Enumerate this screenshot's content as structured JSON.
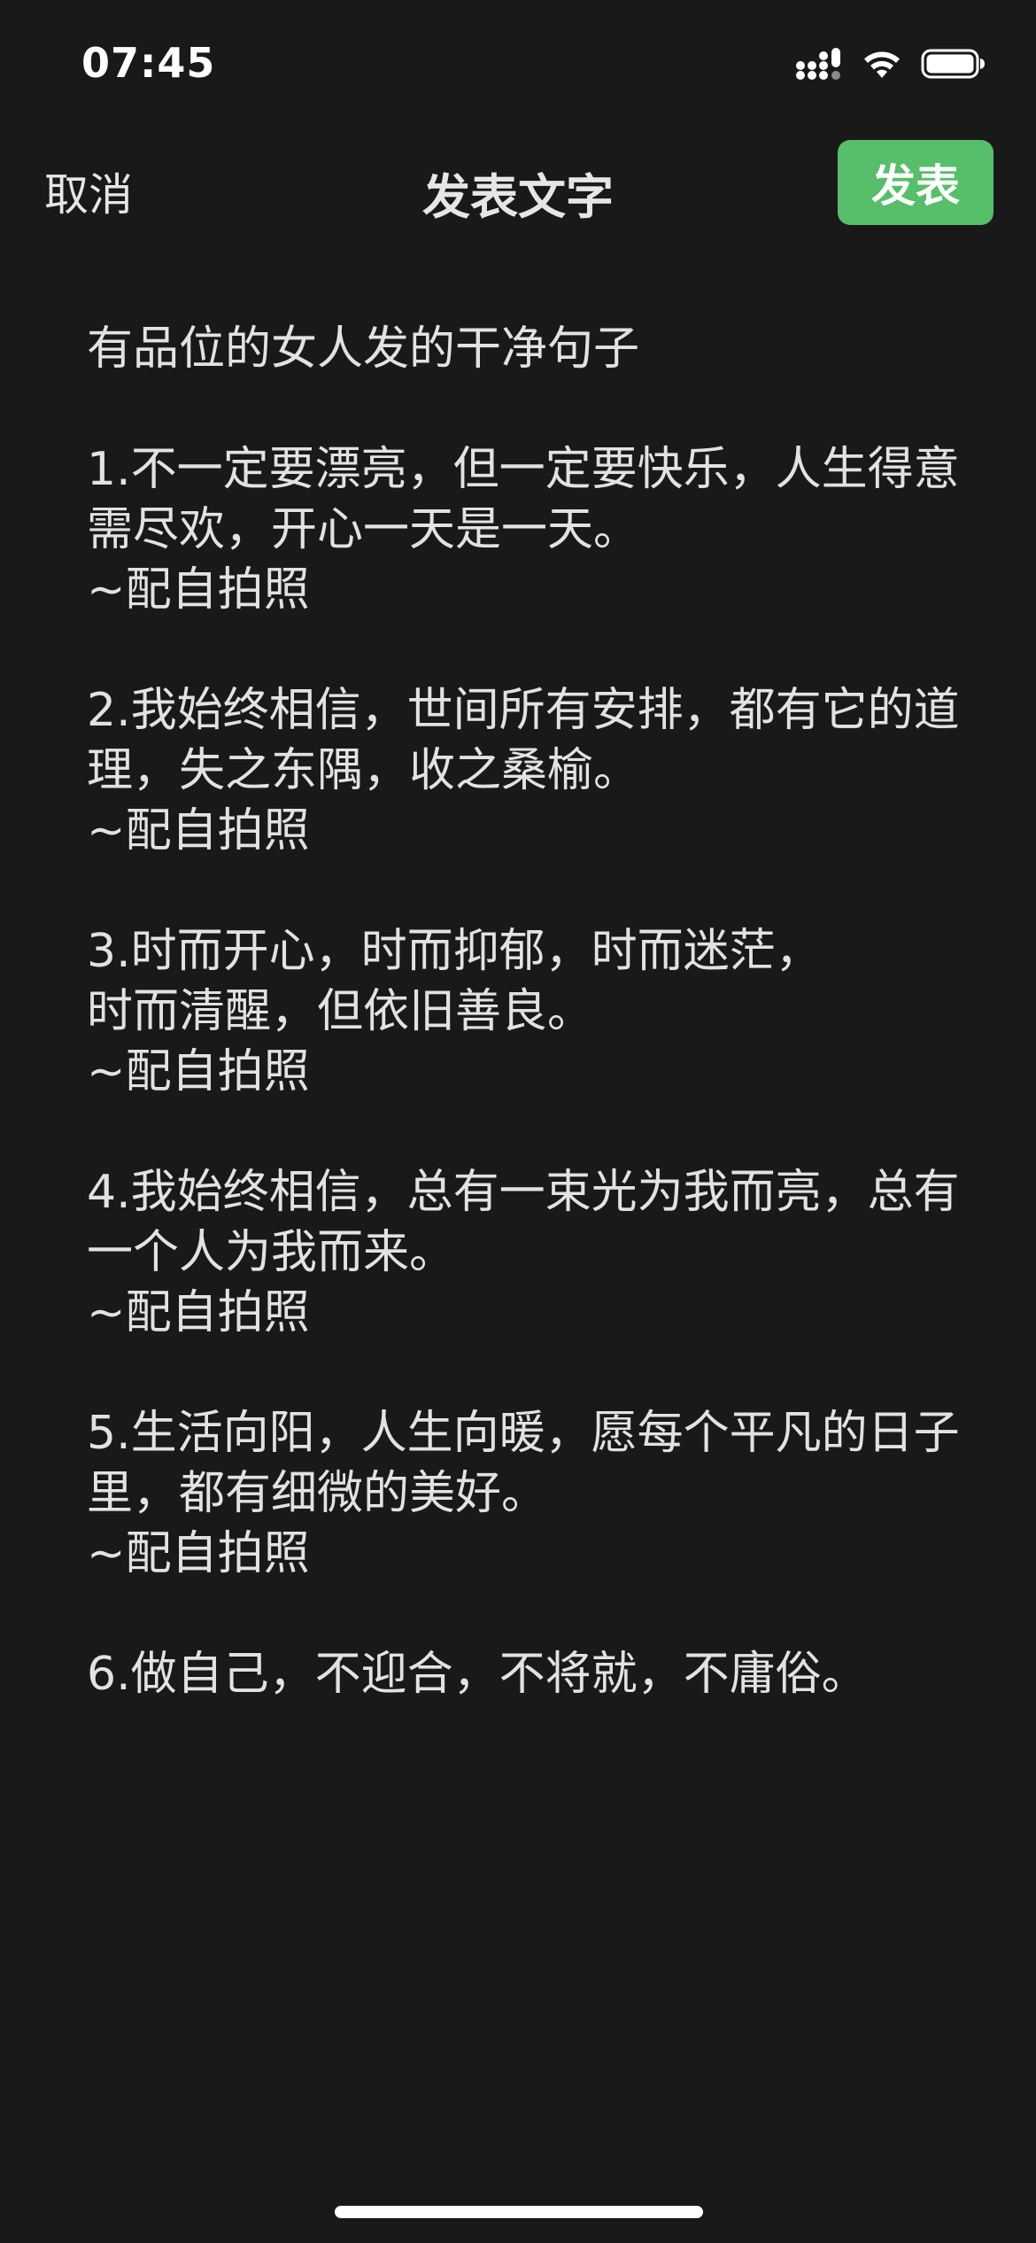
{
  "status_bar": {
    "time": "07:45",
    "icons": [
      "signal-icon",
      "wifi-icon",
      "battery-icon"
    ]
  },
  "nav": {
    "cancel_label": "取消",
    "title": "发表文字",
    "publish_label": "发表"
  },
  "colors": {
    "background": "#191919",
    "accent": "#57be6a",
    "text": "#e6e6e6"
  },
  "editor": {
    "content": "有品位的女人发的干净句子\n\n1.不一定要漂亮，但一定要快乐，人生得意需尽欢，开心一天是一天。\n~配自拍照\n\n2.我始终相信，世间所有安排，都有它的道理，失之东隅，收之桑榆。\n~配自拍照\n\n3.时而开心，时而抑郁，时而迷茫，\n时而清醒，但依旧善良。\n~配自拍照\n\n4.我始终相信，总有一束光为我而亮，总有一个人为我而来。\n~配自拍照\n\n5.生活向阳，人生向暖，愿每个平凡的日子里，都有细微的美好。\n~配自拍照\n\n6.做自己，不迎合，不将就，不庸俗。"
  }
}
